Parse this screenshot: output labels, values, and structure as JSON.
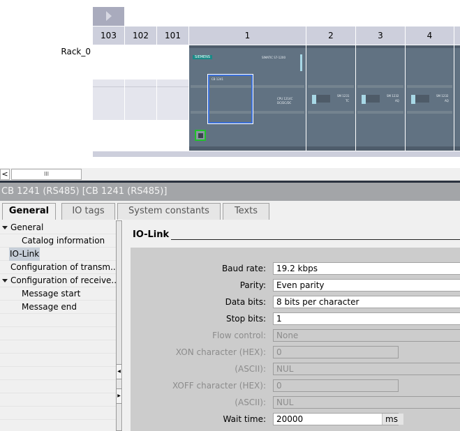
{
  "device_view": {
    "rack_label": "Rack_0",
    "slot_headers": [
      "103",
      "102",
      "101",
      "1",
      "2",
      "3",
      "4"
    ],
    "cpu": {
      "brand": "SIEMENS",
      "series": "SIMATIC S7-1200",
      "model": "CPU 1214C",
      "type": "DC/DC/DC",
      "board": "CB 1241"
    },
    "modules": [
      {
        "name": "SM 1231",
        "type": "TC"
      },
      {
        "name": "SM 1232",
        "type": "AQ"
      },
      {
        "name": "SM 1232",
        "type": "AQ"
      }
    ],
    "colors": {
      "module": "#617282",
      "selection": "#3a6fd8",
      "port_highlight": "#1fc12a"
    }
  },
  "scrollbar": {
    "left_arrow": "<",
    "thumb": "III"
  },
  "inspector": {
    "title": "CB 1241 (RS485) [CB 1241 (RS485)]",
    "tabs": [
      {
        "label": "General",
        "active": true
      },
      {
        "label": "IO tags"
      },
      {
        "label": "System constants"
      },
      {
        "label": "Texts"
      }
    ],
    "tree": [
      {
        "label": "General",
        "expanded": true
      },
      {
        "label": "Catalog information"
      },
      {
        "label": "IO-Link",
        "selected": true
      },
      {
        "label": "Configuration of transm..."
      },
      {
        "label": "Configuration of receive...",
        "expanded": true
      },
      {
        "label": "Message start"
      },
      {
        "label": "Message end"
      }
    ],
    "section_title": "IO-Link",
    "fields": [
      {
        "label": "Baud rate:",
        "value": "19.2 kbps",
        "enabled": true
      },
      {
        "label": "Parity:",
        "value": "Even parity",
        "enabled": true
      },
      {
        "label": "Data bits:",
        "value": "8 bits per character",
        "enabled": true
      },
      {
        "label": "Stop bits:",
        "value": "1",
        "enabled": true
      },
      {
        "label": "Flow control:",
        "value": "None",
        "enabled": false
      },
      {
        "label": "XON character (HEX):",
        "value": "0",
        "enabled": false
      },
      {
        "label": "(ASCII):",
        "value": "NUL",
        "enabled": false
      },
      {
        "label": "XOFF character (HEX):",
        "value": "0",
        "enabled": false
      },
      {
        "label": "(ASCII):",
        "value": "NUL",
        "enabled": false
      },
      {
        "label": "Wait time:",
        "value": "20000",
        "unit": "ms",
        "enabled": true
      }
    ]
  }
}
